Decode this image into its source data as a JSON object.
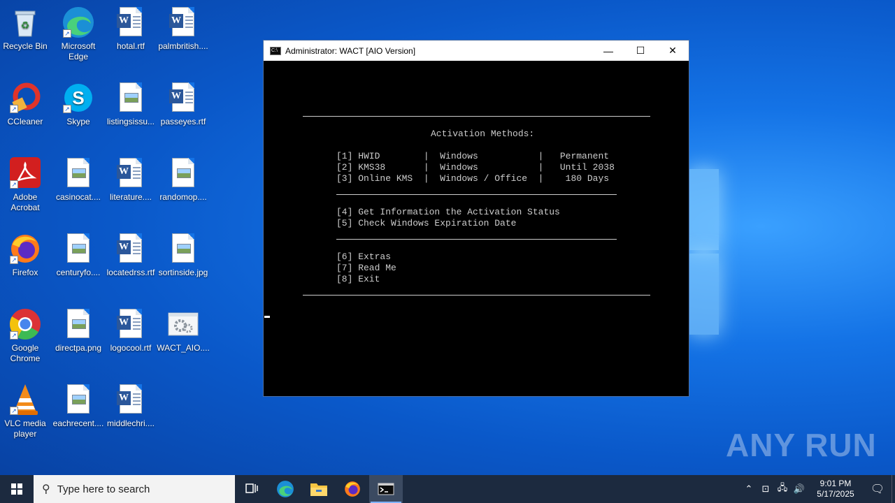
{
  "desktop": {
    "icons": [
      {
        "label": "Recycle Bin",
        "icon": "recycle-bin-icon"
      },
      {
        "label": "Microsoft Edge",
        "icon": "edge-icon"
      },
      {
        "label": "hotal.rtf",
        "icon": "word-document-icon"
      },
      {
        "label": "palmbritish....",
        "icon": "word-document-icon"
      },
      {
        "label": "CCleaner",
        "icon": "ccleaner-icon"
      },
      {
        "label": "Skype",
        "icon": "skype-icon"
      },
      {
        "label": "listingsissu...",
        "icon": "image-file-icon"
      },
      {
        "label": "passeyes.rtf",
        "icon": "word-document-icon"
      },
      {
        "label": "Adobe Acrobat",
        "icon": "acrobat-icon"
      },
      {
        "label": "casinocat....",
        "icon": "image-file-icon"
      },
      {
        "label": "literature....",
        "icon": "word-document-icon"
      },
      {
        "label": "randomop....",
        "icon": "image-file-icon"
      },
      {
        "label": "Firefox",
        "icon": "firefox-icon"
      },
      {
        "label": "centuryfo....",
        "icon": "image-file-icon"
      },
      {
        "label": "locatedrss.rtf",
        "icon": "word-document-icon"
      },
      {
        "label": "sortinside.jpg",
        "icon": "image-file-icon"
      },
      {
        "label": "Google Chrome",
        "icon": "chrome-icon"
      },
      {
        "label": "directpa.png",
        "icon": "image-file-icon"
      },
      {
        "label": "logocool.rtf",
        "icon": "word-document-icon"
      },
      {
        "label": "WACT_AIO....",
        "icon": "settings-executable-icon"
      },
      {
        "label": "VLC media player",
        "icon": "vlc-icon"
      },
      {
        "label": "eachrecent....",
        "icon": "image-file-icon"
      },
      {
        "label": "middlechri....",
        "icon": "word-document-icon"
      }
    ]
  },
  "window": {
    "title": "Administrator:  WACT [AIO Version]",
    "minimize_glyph": "—",
    "maximize_glyph": "☐",
    "close_glyph": "✕",
    "console": {
      "heading": "Activation Methods:",
      "methods": [
        "[1] HWID        |  Windows           |   Permanent",
        "[2] KMS38       |  Windows           |   Until 2038",
        "[3] Online KMS  |  Windows / Office  |    180 Days"
      ],
      "info": [
        "[4] Get Information the Activation Status",
        "[5] Check Windows Expiration Date"
      ],
      "extras": [
        "[6] Extras",
        "[7] Read Me",
        "[8] Exit"
      ]
    }
  },
  "watermark": {
    "text": "ANY RUN"
  },
  "taskbar": {
    "search_placeholder": "Type here to search",
    "apps": [
      "task-view-icon",
      "edge-icon",
      "file-explorer-icon",
      "firefox-icon",
      "command-prompt-icon"
    ],
    "clock_time": "9:01 PM",
    "clock_date": "5/17/2025"
  }
}
